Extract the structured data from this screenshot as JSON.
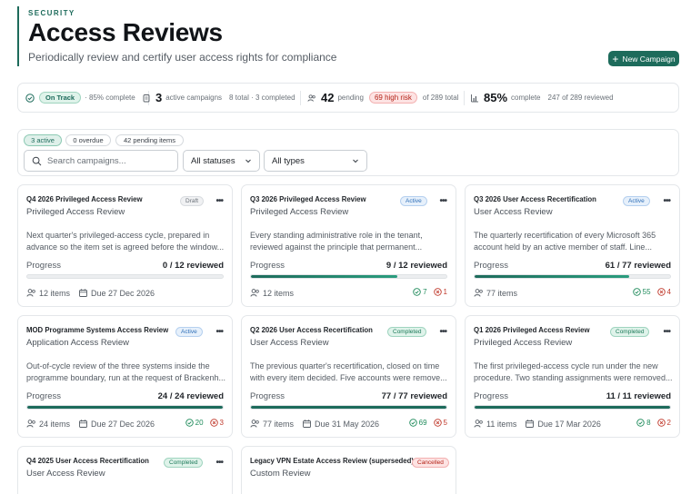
{
  "header": {
    "eyebrow": "SECURITY",
    "title": "Access Reviews",
    "subtitle": "Periodically review and certify user access rights for compliance",
    "new_button": "New Campaign"
  },
  "stats": {
    "status_badge": "On Track",
    "status_detail": "· 85% complete",
    "active_count": "3",
    "active_label": "active campaigns",
    "active_detail": "8 total · 3 completed",
    "pending_count": "42",
    "pending_label": "pending",
    "high_risk": "69 high risk",
    "pending_detail": "of 289 total",
    "complete_pct": "85%",
    "complete_label": "complete",
    "complete_detail": "247 of 289 reviewed"
  },
  "filters": {
    "chips": [
      "3 active",
      "0 overdue",
      "42 pending items"
    ],
    "search_placeholder": "Search campaigns...",
    "status_select": "All statuses",
    "type_select": "All types"
  },
  "labels": {
    "progress": "Progress"
  },
  "colors": {
    "accent": "#1d6b5b",
    "success": "#1d8a5a",
    "danger": "#c0392b",
    "info": "#2f6fb8"
  },
  "campaigns": [
    {
      "title": "Q4 2026 Privileged Access Review",
      "type": "Privileged Access Review",
      "status": "Draft",
      "description": "Next quarter's privileged-access cycle, prepared in advance so the item set is agreed before the window...",
      "progress": "0 / 12 reviewed",
      "fraction": 0,
      "items": "12 items",
      "due": "Due 27 Dec 2026"
    },
    {
      "title": "Q3 2026 Privileged Access Review",
      "type": "Privileged Access Review",
      "status": "Active",
      "description": "Every standing administrative role in the tenant, reviewed against the principle that permanent...",
      "progress": "9 / 12 reviewed",
      "fraction": 0.75,
      "items": "12 items",
      "approved": "7",
      "revoked": "1"
    },
    {
      "title": "Q3 2026 User Access Recertification",
      "type": "User Access Review",
      "status": "Active",
      "description": "The quarterly recertification of every Microsoft 365 account held by an active member of staff. Line...",
      "progress": "61 / 77 reviewed",
      "fraction": 0.792,
      "items": "77 items",
      "approved": "55",
      "revoked": "4"
    },
    {
      "title": "MOD Programme Systems Access Review",
      "type": "Application Access Review",
      "status": "Active",
      "description": "Out-of-cycle review of the three systems inside the programme boundary, run at the request of Brackenh...",
      "progress": "24 / 24 reviewed",
      "fraction": 1,
      "items": "24 items",
      "due": "Due 27 Dec 2026",
      "approved": "20",
      "revoked": "3"
    },
    {
      "title": "Q2 2026 User Access Recertification",
      "type": "User Access Review",
      "status": "Completed",
      "description": "The previous quarter's recertification, closed on time with every item decided. Five accounts were remove...",
      "progress": "77 / 77 reviewed",
      "fraction": 1,
      "items": "77 items",
      "due": "Due 31 May 2026",
      "approved": "69",
      "revoked": "5"
    },
    {
      "title": "Q1 2026 Privileged Access Review",
      "type": "Privileged Access Review",
      "status": "Completed",
      "description": "The first privileged-access cycle run under the new procedure. Two standing assignments were removed...",
      "progress": "11 / 11 reviewed",
      "fraction": 1,
      "items": "11 items",
      "due": "Due 17 Mar 2026",
      "approved": "8",
      "revoked": "2"
    },
    {
      "title": "Q4 2025 User Access Recertification",
      "type": "User Access Review",
      "status": "Completed"
    },
    {
      "title": "Legacy VPN Estate Access Review (superseded)",
      "type": "Custom Review",
      "status": "Cancelled"
    }
  ]
}
